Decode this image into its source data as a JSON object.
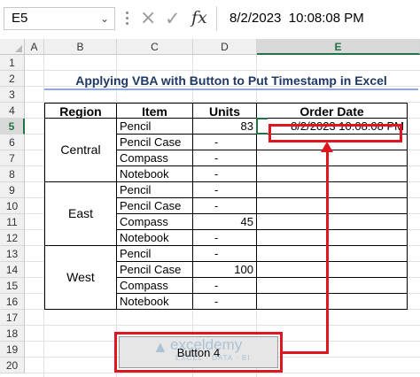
{
  "formula_bar": {
    "name_box": "E5",
    "cancel_icon": "×",
    "enter_icon": "✓",
    "fx_label": "fx",
    "value": "8/2/2023  10:08:08 PM"
  },
  "columns": [
    "A",
    "B",
    "C",
    "D",
    "E"
  ],
  "rows": [
    "1",
    "2",
    "3",
    "4",
    "5",
    "6",
    "7",
    "8",
    "9",
    "10",
    "11",
    "12",
    "13",
    "14",
    "15",
    "16",
    "17",
    "18",
    "19",
    "20"
  ],
  "title": "Applying VBA with Button to Put Timestamp in Excel",
  "table": {
    "headers": [
      "Region",
      "Item",
      "Units",
      "Order Date"
    ],
    "groups": [
      {
        "region": "Central",
        "rows": [
          {
            "item": "Pencil",
            "units": "83",
            "date": "8/2/2023 10:08:08 PM"
          },
          {
            "item": "Pencil Case",
            "units": "-",
            "date": ""
          },
          {
            "item": "Compass",
            "units": "-",
            "date": ""
          },
          {
            "item": "Notebook",
            "units": "-",
            "date": ""
          }
        ]
      },
      {
        "region": "East",
        "rows": [
          {
            "item": "Pencil",
            "units": "-",
            "date": ""
          },
          {
            "item": "Pencil Case",
            "units": "-",
            "date": ""
          },
          {
            "item": "Compass",
            "units": "45",
            "date": ""
          },
          {
            "item": "Notebook",
            "units": "-",
            "date": ""
          }
        ]
      },
      {
        "region": "West",
        "rows": [
          {
            "item": "Pencil",
            "units": "-",
            "date": ""
          },
          {
            "item": "Pencil Case",
            "units": "100",
            "date": ""
          },
          {
            "item": "Compass",
            "units": "-",
            "date": ""
          },
          {
            "item": "Notebook",
            "units": "-",
            "date": ""
          }
        ]
      }
    ]
  },
  "button": {
    "label": "Button 4"
  },
  "watermark": {
    "brand": "exceldemy",
    "tagline": "EXCEL · DATA · BI"
  },
  "colors": {
    "accent": "#217346",
    "annotation": "#e0161e",
    "title": "#1f3864"
  }
}
